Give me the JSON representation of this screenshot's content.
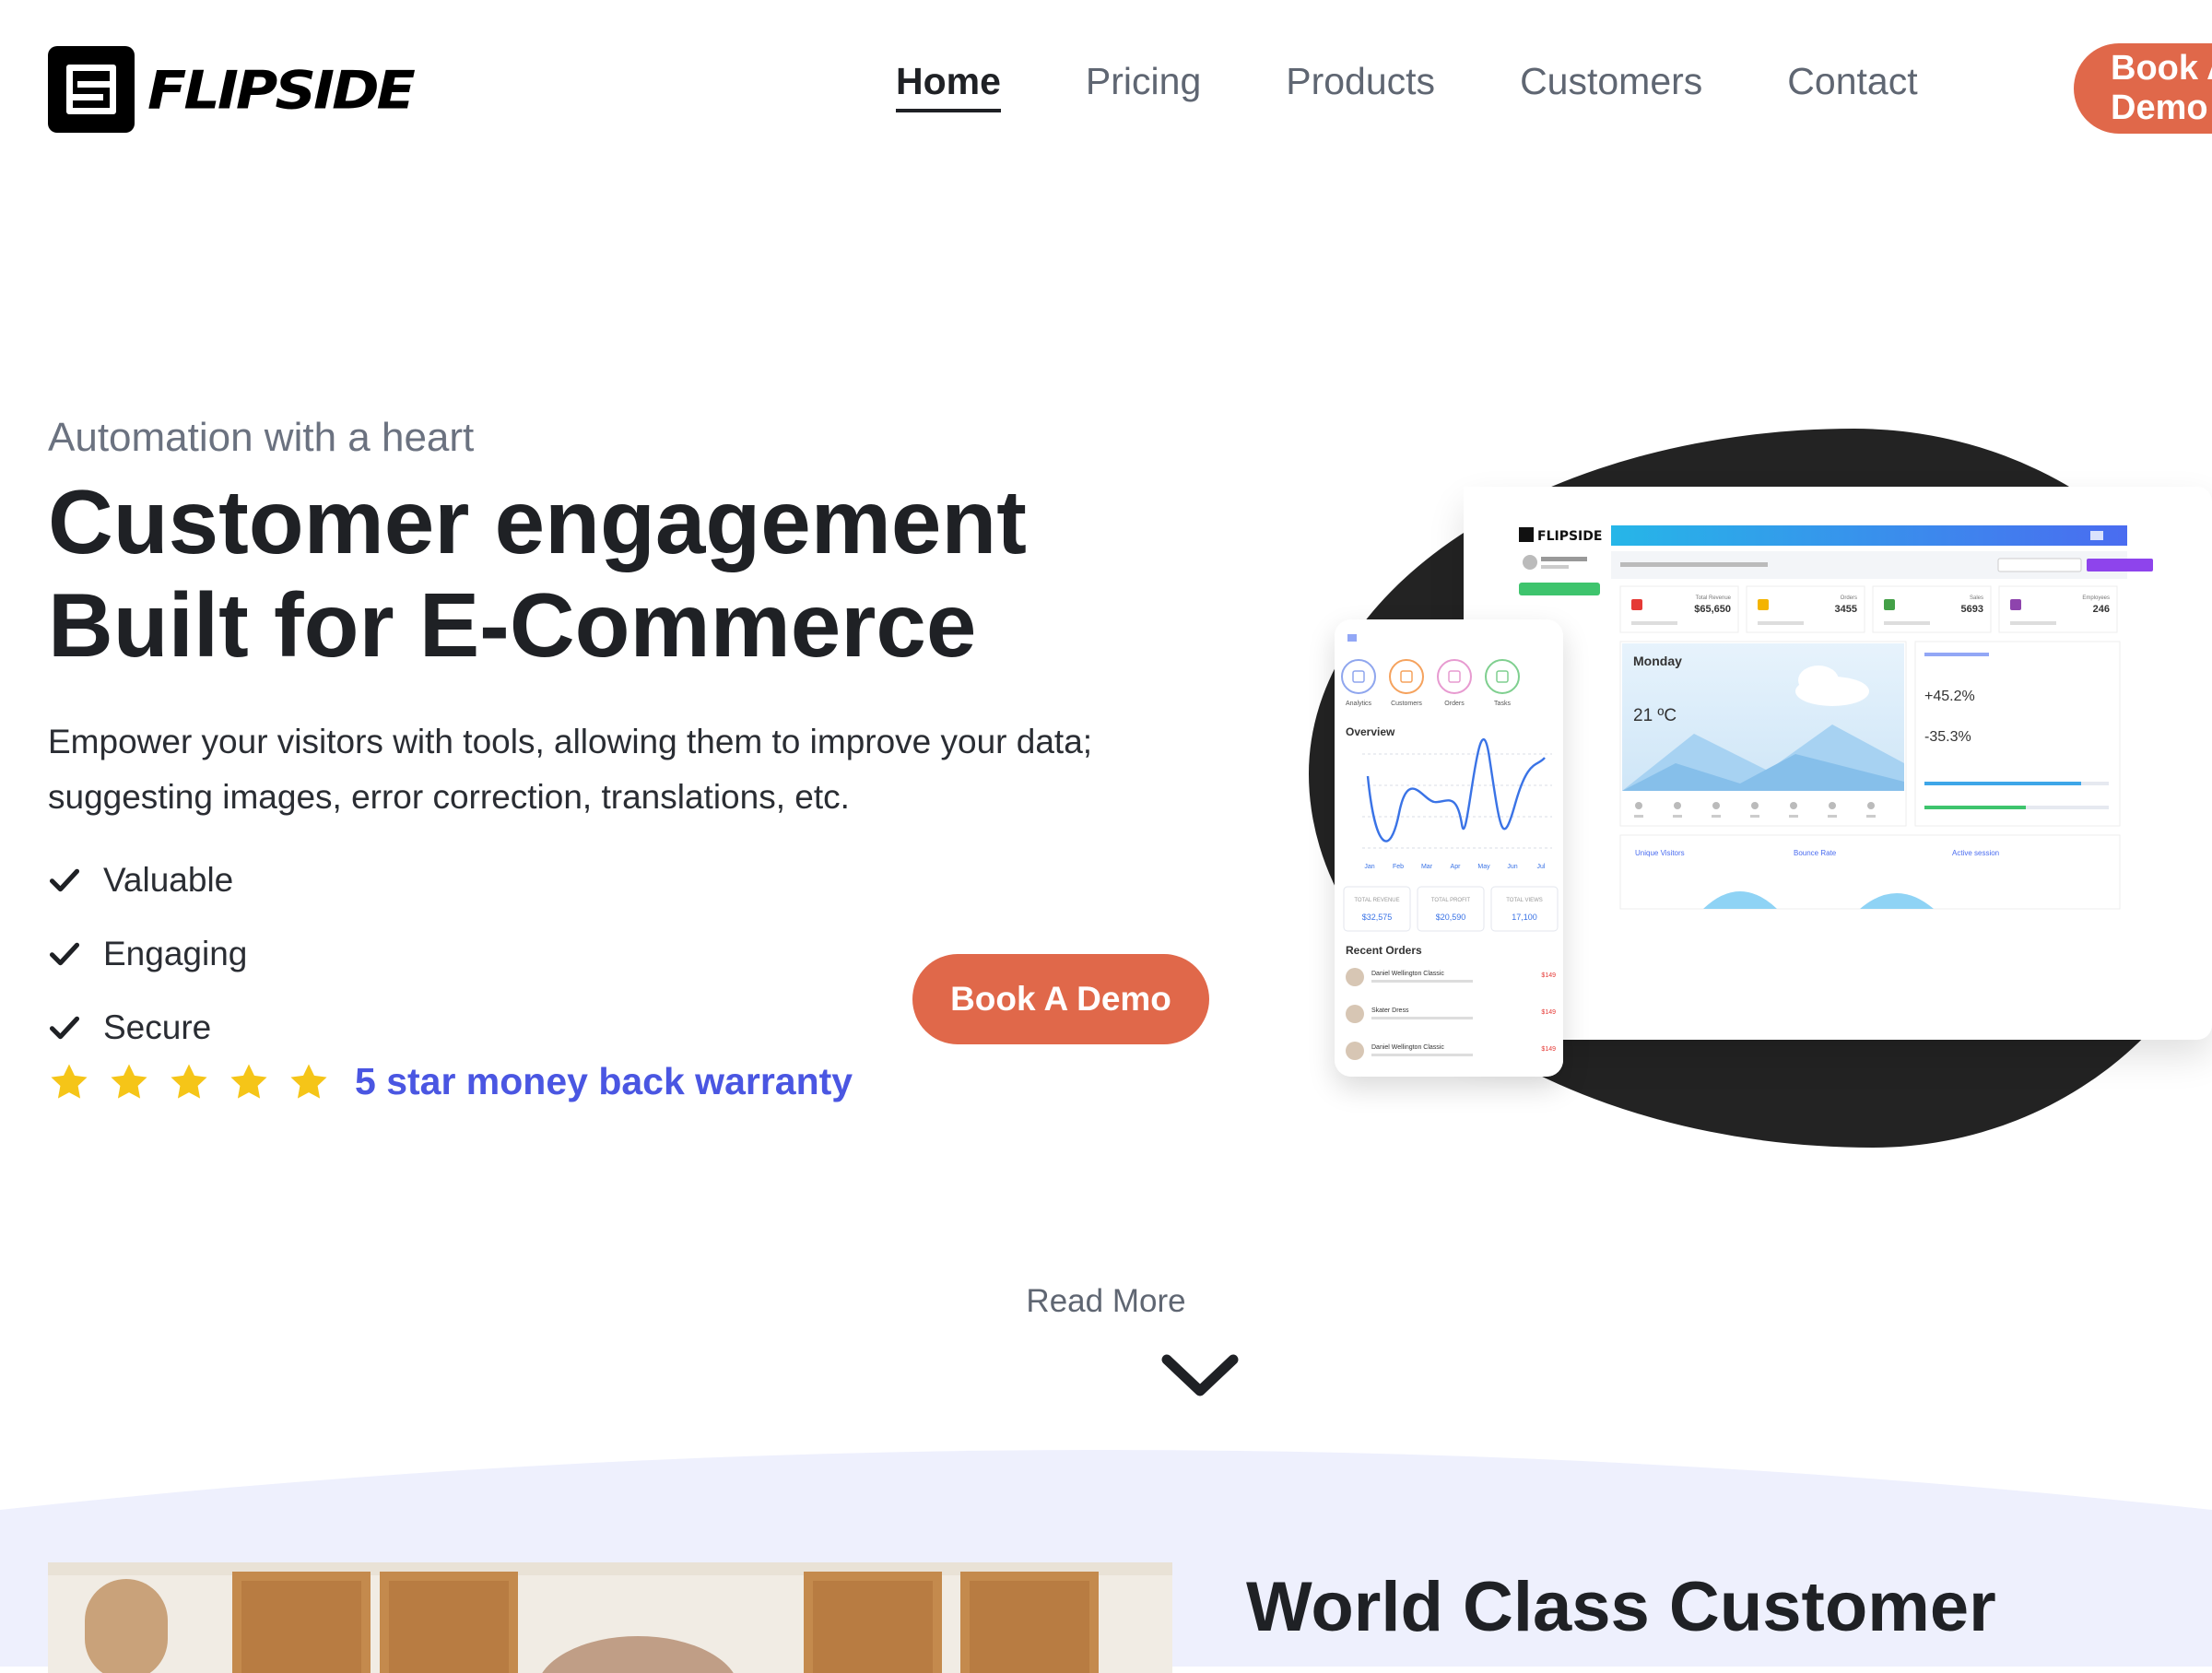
{
  "header": {
    "logo_text": "FLIPSIDE",
    "nav": [
      {
        "label": "Home",
        "active": true
      },
      {
        "label": "Pricing",
        "active": false
      },
      {
        "label": "Products",
        "active": false
      },
      {
        "label": "Customers",
        "active": false
      },
      {
        "label": "Contact",
        "active": false
      }
    ],
    "cta_label": "Book A Demo"
  },
  "hero": {
    "tagline": "Automation with a heart",
    "headline_line1": "Customer engagement",
    "headline_line2": "Built for E-Commerce",
    "description": "Empower your visitors with tools, allowing them to improve your data; suggesting images, error correction, translations, etc.",
    "features": [
      "Valuable",
      "Engaging",
      "Secure"
    ],
    "rating_stars": 5,
    "warranty_text": "5 star money back warranty",
    "cta_label": "Book A Demo"
  },
  "mockup": {
    "brand": "FLIPSIDE",
    "stats": [
      {
        "label": "Total Revenue",
        "value": "$65,650",
        "color": "#e53935"
      },
      {
        "label": "Orders",
        "value": "3455",
        "color": "#f4b400"
      },
      {
        "label": "Sales",
        "value": "5693",
        "color": "#43a047"
      },
      {
        "label": "Employees",
        "value": "246",
        "color": "#8e44ad"
      }
    ],
    "weather_day": "Monday",
    "weather_temp": "21 ºC",
    "perf_best": "+45.2%",
    "perf_worst": "-35.3%",
    "visitor_labels": [
      "Unique Visitors",
      "Bounce Rate",
      "Active session"
    ],
    "phone_icons": [
      "Analytics",
      "Customers",
      "Orders",
      "Tasks"
    ],
    "overview_title": "Overview",
    "months": [
      "Jan",
      "Feb",
      "Mar",
      "Apr",
      "May",
      "Jun",
      "Jul"
    ],
    "totals": [
      {
        "label": "TOTAL REVENUE",
        "value": "$32,575"
      },
      {
        "label": "TOTAL PROFIT",
        "value": "$20,590"
      },
      {
        "label": "TOTAL VIEWS",
        "value": "17,100"
      }
    ],
    "recent_orders_title": "Recent Orders",
    "orders": [
      {
        "name": "Daniel Wellington Classic",
        "price": "$149"
      },
      {
        "name": "Skater Dress",
        "price": "$149"
      },
      {
        "name": "Daniel Wellington Classic",
        "price": "$149"
      }
    ]
  },
  "read_more_label": "Read More",
  "section": {
    "title": "World Class Customer"
  },
  "colors": {
    "accent": "#e0684a",
    "link": "#4a56e2",
    "star": "#f5c518",
    "band": "#eef0fd"
  }
}
